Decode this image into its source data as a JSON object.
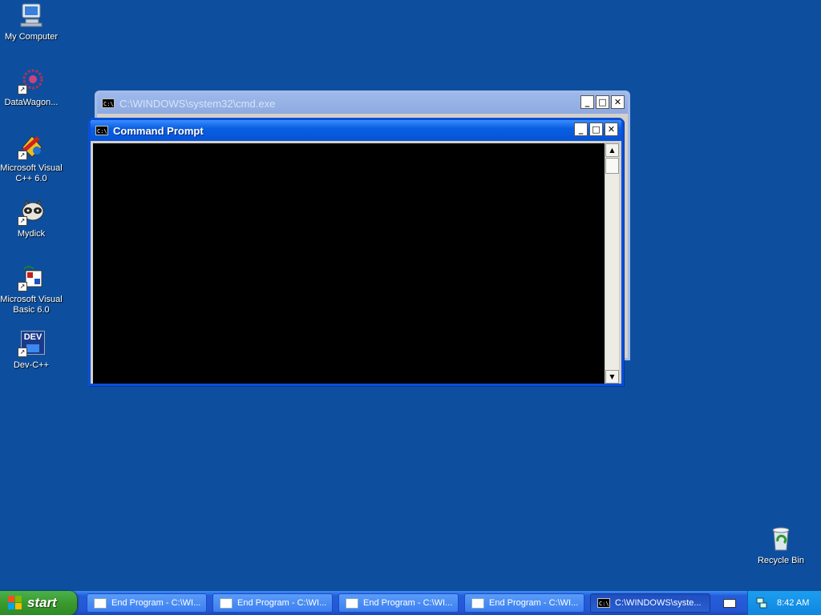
{
  "desktop": {
    "icons": [
      {
        "label": "My Computer"
      },
      {
        "label": "DataWagon..."
      },
      {
        "label": "Microsoft Visual C++ 6.0"
      },
      {
        "label": "Mydick"
      },
      {
        "label": "Microsoft Visual Basic 6.0"
      },
      {
        "label": "Dev-C++",
        "badge": "DEV"
      },
      {
        "label": "Recycle Bin"
      }
    ]
  },
  "windows": {
    "back": {
      "title": "C:\\WINDOWS\\system32\\cmd.exe",
      "icon_text": "C:\\"
    },
    "front": {
      "title": "Command Prompt",
      "icon_text": "C:\\"
    }
  },
  "controls": {
    "minimize": "_",
    "maximize": "□",
    "close": "✕"
  },
  "scroll": {
    "up": "▲",
    "down": "▼"
  },
  "taskbar": {
    "start_label": "start",
    "tasks": [
      {
        "label": "End Program - C:\\WI..."
      },
      {
        "label": "End Program - C:\\WI..."
      },
      {
        "label": "End Program - C:\\WI..."
      },
      {
        "label": "End Program - C:\\WI..."
      },
      {
        "label": "C:\\WINDOWS\\syste..."
      }
    ],
    "clock": "8:42 AM"
  },
  "colors": {
    "desktop": "#0d4f9e",
    "titlebar_active": "#0a5fe0",
    "titlebar_inactive": "#9db9eb",
    "start_button": "#3a9a2e",
    "console": "#000000"
  }
}
